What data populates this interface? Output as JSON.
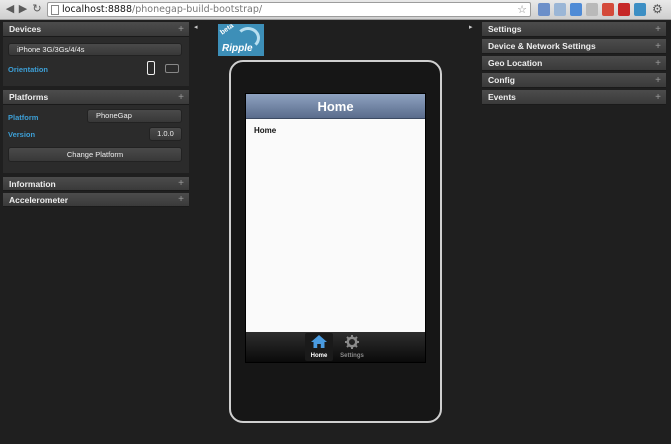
{
  "browser": {
    "url_host": "localhost:8888",
    "url_path": "/phonegap-build-bootstrap/"
  },
  "left_panel": {
    "devices": {
      "title": "Devices",
      "selected_device": "iPhone 3G/3Gs/4/4s",
      "orientation_label": "Orientation"
    },
    "platforms": {
      "title": "Platforms",
      "platform_label": "Platform",
      "platform_value": "PhoneGap",
      "version_label": "Version",
      "version_value": "1.0.0",
      "change_button": "Change Platform"
    },
    "information": {
      "title": "Information"
    },
    "accelerometer": {
      "title": "Accelerometer"
    }
  },
  "logo": {
    "badge": "beta",
    "text": "Ripple"
  },
  "phone": {
    "header_title": "Home",
    "content_text": "Home",
    "tabs": [
      {
        "label": "Home",
        "icon": "home-icon",
        "active": true
      },
      {
        "label": "Settings",
        "icon": "gear-icon",
        "active": false
      }
    ]
  },
  "right_panel": {
    "sections": [
      {
        "title": "Settings"
      },
      {
        "title": "Device & Network Settings"
      },
      {
        "title": "Geo Location"
      },
      {
        "title": "Config"
      },
      {
        "title": "Events"
      }
    ]
  },
  "colors": {
    "accent_label": "#3d9fd6",
    "active_tab": "#4a9be0",
    "header_blue": "#6f82a3"
  }
}
